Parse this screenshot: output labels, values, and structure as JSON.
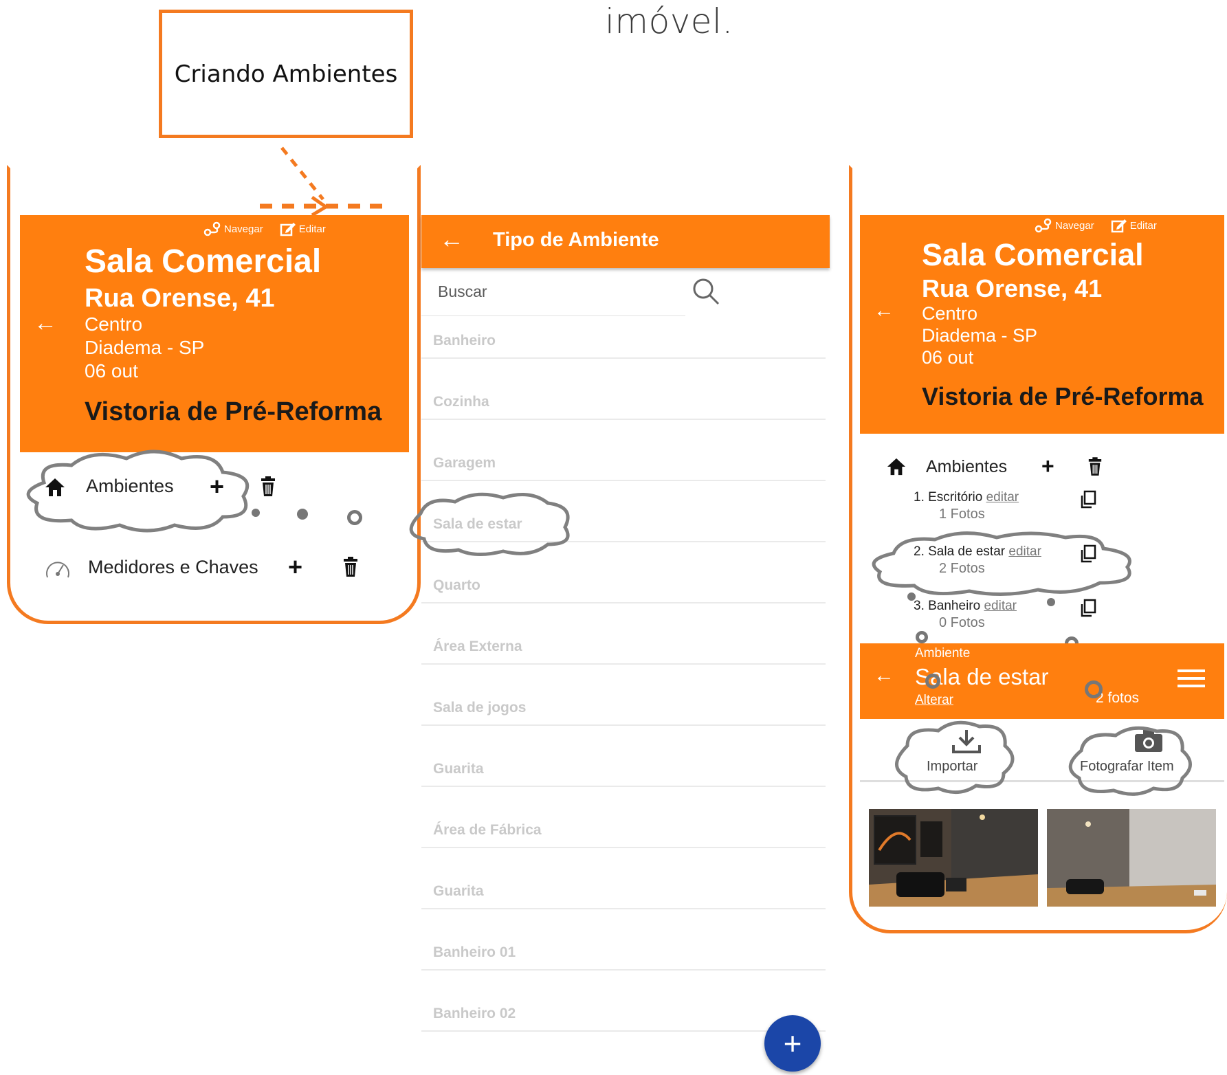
{
  "page": {
    "top_title": "imóvel.",
    "callout_label": "Criando Ambientes"
  },
  "colors": {
    "brand_orange": "#ff7f0f",
    "frame_orange": "#f47a20",
    "fab_blue": "#1b46a8"
  },
  "property_screen": {
    "nav_label": "Navegar",
    "edit_label": "Editar",
    "title": "Sala Comercial",
    "street": "Rua Orense, 41",
    "district": "Centro",
    "city": "Diadema - SP",
    "date": "06 out",
    "inspection": "Vistoria de Pré-Reforma",
    "sections": {
      "environments": "Ambientes",
      "meters": "Medidores e Chaves"
    }
  },
  "type_screen": {
    "title": "Tipo de Ambiente",
    "search_placeholder": "Buscar",
    "items": [
      "Banheiro",
      "Cozinha",
      "Garagem",
      "Sala de estar",
      "Quarto",
      "Área Externa",
      "Sala de jogos",
      "Guarita",
      "Área de Fábrica",
      "Guarita",
      "Banheiro 01",
      "Banheiro 02"
    ],
    "fab_label": "+"
  },
  "detail_screen": {
    "environments_label": "Ambientes",
    "environments": [
      {
        "name": "1. Escritório",
        "edit": "editar",
        "photos": "1 Fotos"
      },
      {
        "name": "2. Sala de estar",
        "edit": "editar",
        "photos": "2 Fotos"
      },
      {
        "name": "3. Banheiro",
        "edit": "editar",
        "photos": "0 Fotos"
      }
    ],
    "sub_header": {
      "caption": "Ambiente",
      "name": "Sala de estar",
      "change": "Alterar",
      "photo_count": "2 fotos"
    },
    "tools": {
      "import": "Importar",
      "photograph": "Fotografar Item"
    }
  }
}
